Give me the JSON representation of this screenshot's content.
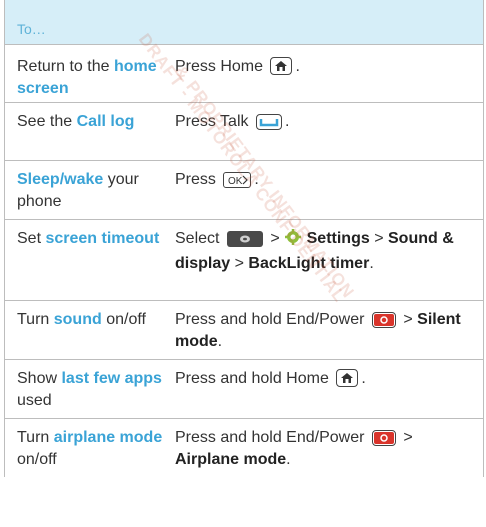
{
  "header": {
    "title": "To…"
  },
  "watermark": {
    "line1": "DRAFT - MOTOROLA CONFIDENTIAL",
    "line2": "& PROPRIETARY INFORMATION"
  },
  "rows": [
    {
      "left_pre": "Return to the ",
      "left_hl": "home screen",
      "left_post": "",
      "right_pre": "Press Home",
      "right_post": "."
    },
    {
      "left_pre": "See the ",
      "left_hl": "Call log",
      "left_post": "",
      "right_pre": "Press Talk",
      "right_post": "."
    },
    {
      "left_pre": "",
      "left_hl": "Sleep/wake",
      "left_post": " your phone",
      "right_pre": "Press",
      "right_post": "."
    },
    {
      "left_pre": "Set ",
      "left_hl": "screen timeout",
      "left_post": "",
      "right_pre": "Select",
      "right_mid": ">",
      "right_settings": "Settings",
      "right_gt2": ">",
      "right_b1": "Sound & display",
      "right_gt3": ">",
      "right_b2": "BackLight timer",
      "right_post": "."
    },
    {
      "left_pre": "Turn ",
      "left_hl": "sound",
      "left_post": " on/off",
      "right_pre": "Press and hold End/Power",
      "right_gt": ">",
      "right_b": "Silent mode",
      "right_post": "."
    },
    {
      "left_pre": "Show ",
      "left_hl": "last few apps",
      "left_post": " used",
      "right_pre": "Press and hold Home",
      "right_post": "."
    },
    {
      "left_pre": "Turn ",
      "left_hl": "airplane mode",
      "left_post": " on/off",
      "right_pre": "Press and hold End/Power",
      "right_gt": ">",
      "right_b": "Airplane mode",
      "right_post": "."
    }
  ],
  "icons": {
    "home": "home-key-icon",
    "talk": "talk-key-icon",
    "ok": "ok-key-icon",
    "menu": "menu-key-icon",
    "settings": "gear-icon",
    "power": "end-power-key-icon",
    "accent": "#3aa3d6",
    "power_color": "#d9342b"
  }
}
